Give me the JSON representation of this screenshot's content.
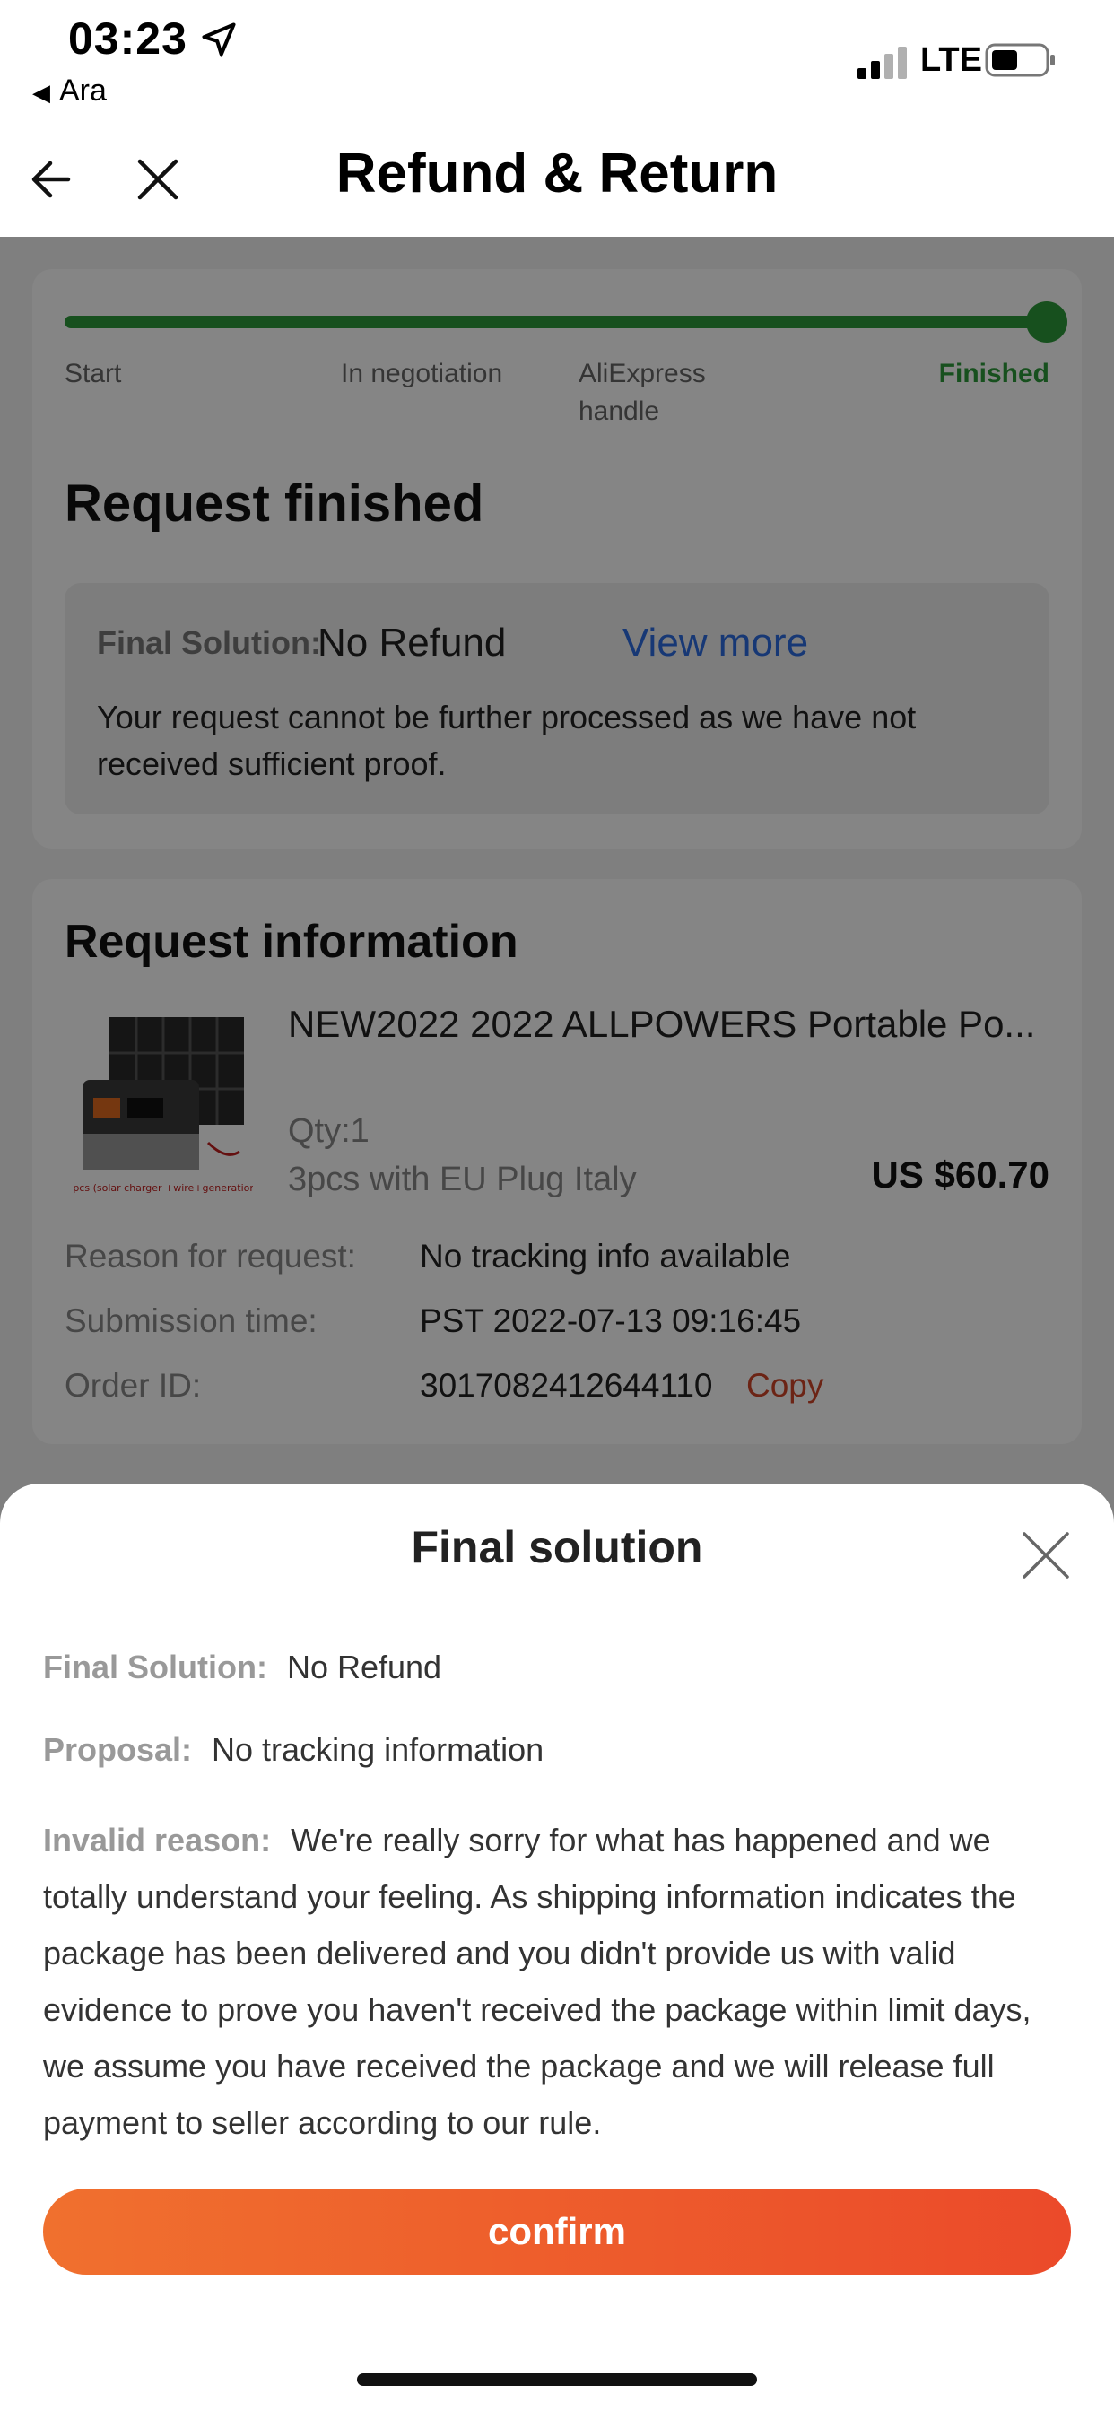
{
  "status_bar": {
    "time": "03:23",
    "back_app": "Ara",
    "network": "LTE",
    "icons": [
      "location-arrow-icon",
      "signal-icon",
      "battery-icon"
    ]
  },
  "nav": {
    "title": "Refund & Return",
    "icons": [
      "back-arrow-icon",
      "close-icon"
    ]
  },
  "progress": {
    "steps": [
      "Start",
      "In negotiation",
      "AliExpress handle",
      "Finished"
    ],
    "active_step": "Finished",
    "fraction_complete": 1.0,
    "color": "#2c9a3a"
  },
  "request_status": {
    "title": "Request finished",
    "final_solution_label": "Final Solution:",
    "final_solution_value": "No Refund",
    "view_more": "View more",
    "description": "Your request cannot be further processed as we have not received sufficient proof."
  },
  "request_info": {
    "title": "Request information",
    "product": {
      "name": "NEW2022 2022 ALLPOWERS Portable Po...",
      "qty": "Qty:1",
      "variant": "3pcs with EU Plug Italy",
      "price": "US $60.70",
      "thumb_caption": "3pcs (solar charger +wire+generation)"
    },
    "rows": [
      {
        "key": "Reason for request:",
        "value": "No tracking info available"
      },
      {
        "key": "Submission time:",
        "value": "PST 2022-07-13 09:16:45"
      },
      {
        "key": "Order ID:",
        "value": "3017082412644110"
      }
    ],
    "copy_label": "Copy"
  },
  "sheet": {
    "title": "Final solution",
    "final_solution_label": "Final Solution:",
    "final_solution_value": "No Refund",
    "proposal_label": "Proposal:",
    "proposal_value": "No tracking information",
    "invalid_label": "Invalid reason:",
    "invalid_value": "We're really sorry for what has happened and we totally understand your feeling. As shipping information indicates the package has been delivered and you didn't provide us with valid evidence to prove you haven't received the package within limit days, we assume you have received the package and we will release full payment to seller according to our rule.",
    "confirm_label": "confirm",
    "confirm_colors": [
      "#f0702e",
      "#eb4a2a"
    ]
  }
}
